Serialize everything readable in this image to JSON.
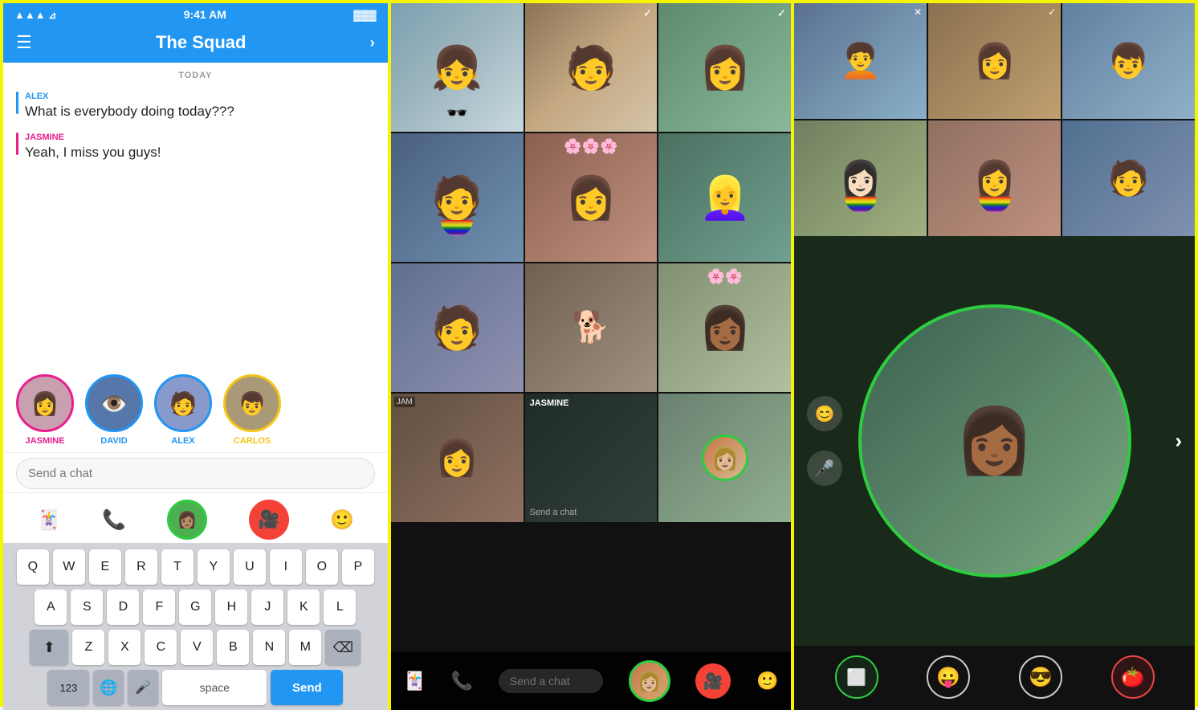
{
  "panel1": {
    "statusBar": {
      "signal": "●●●",
      "wifi": "wifi",
      "time": "9:41 AM",
      "battery": "🔋"
    },
    "header": {
      "title": "The Squad",
      "menuIcon": "☰",
      "chevron": "›"
    },
    "dateLabel": "TODAY",
    "messages": [
      {
        "sender": "ALEX",
        "senderClass": "alex",
        "text": "What is everybody doing today???",
        "accentClass": "alex"
      },
      {
        "sender": "JASMINE",
        "senderClass": "jasmine",
        "text": "Yeah, I miss you guys!",
        "accentClass": "jasmine"
      }
    ],
    "members": [
      {
        "name": "JASMINE",
        "class": "jasmine",
        "emoji": "👩"
      },
      {
        "name": "DAVID",
        "class": "david",
        "emoji": "👁️"
      },
      {
        "name": "ALEX",
        "class": "alex",
        "emoji": "🧑"
      },
      {
        "name": "CARLOS",
        "class": "carlos",
        "emoji": "👦"
      }
    ],
    "sendPlaceholder": "Send a chat",
    "actionIcons": {
      "sticker": "🃏",
      "phone": "📞",
      "emoji": "🙂"
    },
    "sendButton": "Send",
    "keyboard": {
      "row1": [
        "Q",
        "W",
        "E",
        "R",
        "T",
        "Y",
        "U",
        "I",
        "O",
        "P"
      ],
      "row2": [
        "A",
        "S",
        "D",
        "F",
        "G",
        "H",
        "J",
        "K",
        "L"
      ],
      "row3": [
        "Z",
        "X",
        "C",
        "V",
        "B",
        "N",
        "M"
      ],
      "bottomLeft": "123",
      "emojiKey": "🌐",
      "micKey": "🎤",
      "spaceLabel": "space",
      "sendLabel": "Send",
      "shiftIcon": "⬆",
      "deleteIcon": "⌫"
    }
  },
  "panel2": {
    "videoGrid": {
      "cells": [
        {
          "id": 1,
          "class": "vc1"
        },
        {
          "id": 2,
          "class": "vc2"
        },
        {
          "id": 3,
          "class": "vc3"
        },
        {
          "id": 4,
          "class": "vc4"
        },
        {
          "id": 5,
          "class": "vc5"
        },
        {
          "id": 6,
          "class": "vc6"
        },
        {
          "id": 7,
          "class": "vc7"
        },
        {
          "id": 8,
          "class": "vc8"
        },
        {
          "id": 9,
          "class": "vc9"
        },
        {
          "id": 10,
          "class": "vc10"
        },
        {
          "id": 11,
          "class": "vc11"
        },
        {
          "id": 12,
          "class": "vc12"
        }
      ],
      "checkmark": "✓"
    },
    "bottomBar": {
      "sendPlaceholder": "Send a chat",
      "stickerIcon": "🃏",
      "phoneIcon": "📞",
      "emojiIcon": "🙂"
    },
    "nameLabels": {
      "jasmine": "JASMINE",
      "jam": "JAM"
    }
  },
  "panel3": {
    "topGrid": {
      "cells": [
        {
          "id": 1,
          "class": "cc1"
        },
        {
          "id": 2,
          "class": "cc2"
        },
        {
          "id": 3,
          "class": "cc3"
        },
        {
          "id": 4,
          "class": "cc4"
        },
        {
          "id": 5,
          "class": "cc5"
        },
        {
          "id": 6,
          "class": "cc6"
        }
      ],
      "checkmark": "✕"
    },
    "callView": {
      "sideIcons": {
        "filter": "😊",
        "mic": "🎤"
      },
      "chevron": "›",
      "circleContent": "👩🏾"
    },
    "bottomBar": {
      "buttons": [
        {
          "id": "camera",
          "icon": "⬜",
          "active": true
        },
        {
          "id": "face",
          "icon": "😛",
          "active": false
        },
        {
          "id": "glasses",
          "icon": "😎",
          "active": false
        },
        {
          "id": "tomato",
          "icon": "🍅",
          "active": false
        }
      ]
    }
  }
}
